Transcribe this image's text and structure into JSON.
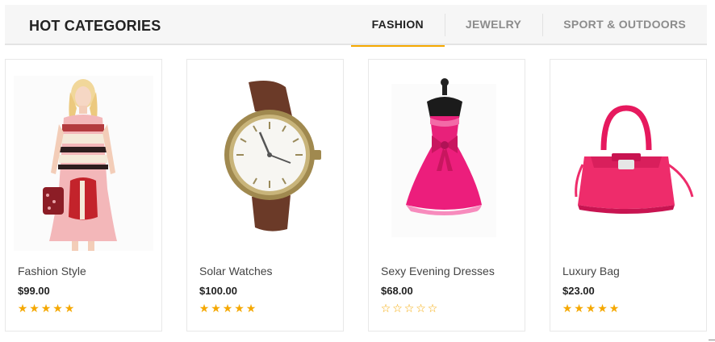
{
  "header": {
    "title": "HOT CATEGORIES"
  },
  "tabs": [
    {
      "label": "FASHION",
      "active": true
    },
    {
      "label": "JEWELRY",
      "active": false
    },
    {
      "label": "SPORT & OUTDOORS",
      "active": false
    }
  ],
  "accent_color": "#f5a800",
  "products": [
    {
      "name": "Fashion Style",
      "price": "$99.00",
      "rating": 5,
      "rating_max": 5,
      "image": "dress-model-image"
    },
    {
      "name": "Solar Watches",
      "price": "$100.00",
      "rating": 5,
      "rating_max": 5,
      "image": "wristwatch-image"
    },
    {
      "name": "Sexy Evening Dresses",
      "price": "$68.00",
      "rating": 0,
      "rating_max": 5,
      "image": "pink-dress-image"
    },
    {
      "name": "Luxury Bag",
      "price": "$23.00",
      "rating": 5,
      "rating_max": 5,
      "image": "pink-handbag-image"
    }
  ]
}
